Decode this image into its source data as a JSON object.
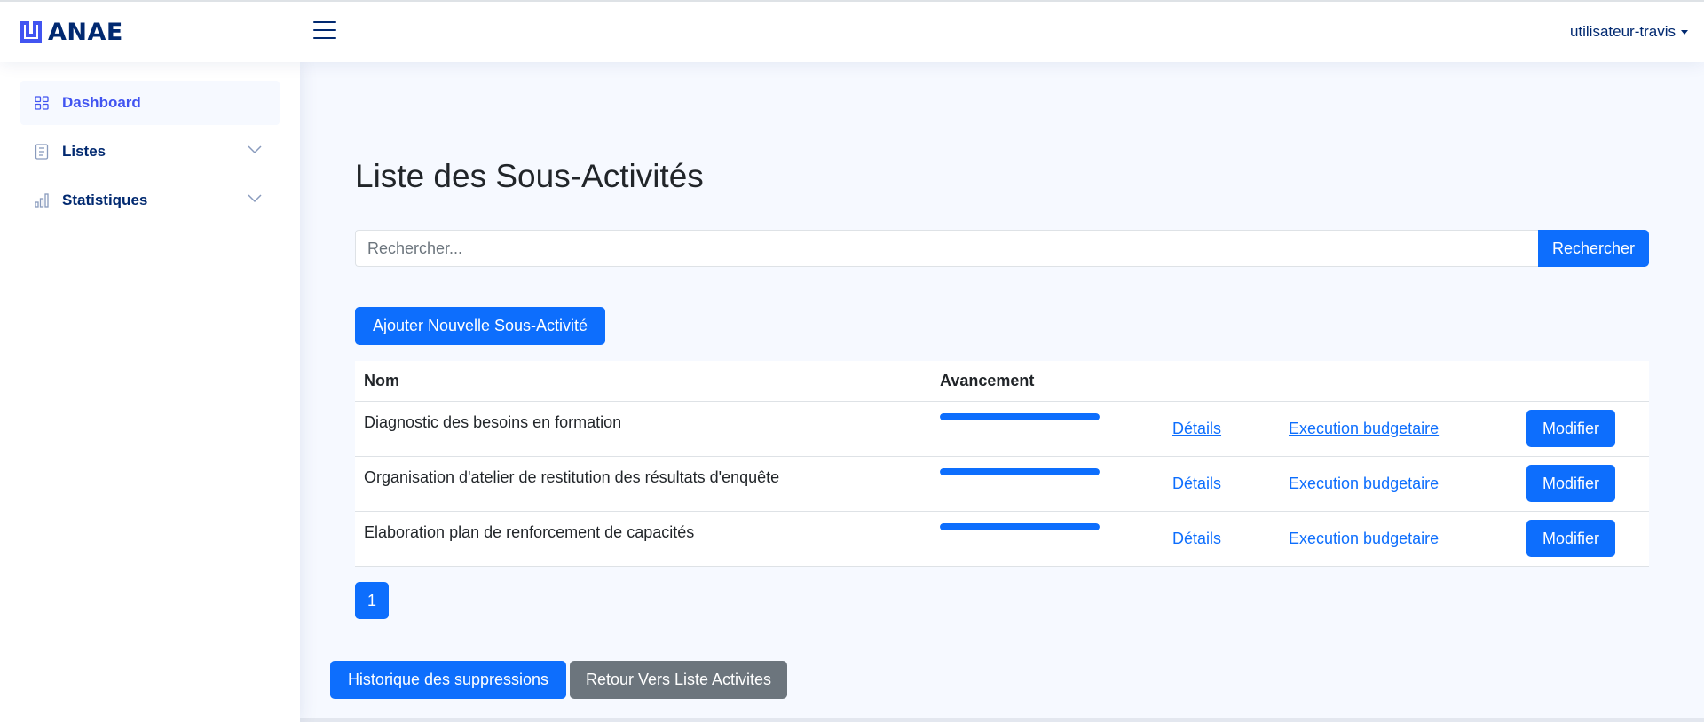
{
  "brand": {
    "name": "ANAE",
    "accent": "#4154f1",
    "primary": "#0d6efd"
  },
  "header": {
    "menu_icon": "hamburger-icon",
    "user": "utilisateur-travis"
  },
  "sidebar": {
    "items": [
      {
        "label": "Dashboard",
        "icon": "grid-icon"
      },
      {
        "label": "Listes",
        "icon": "list-icon"
      },
      {
        "label": "Statistiques",
        "icon": "bar-chart-icon"
      }
    ]
  },
  "main": {
    "title": "Liste des Sous-Activités",
    "search": {
      "placeholder": "Rechercher...",
      "button": "Rechercher"
    },
    "add_button": "Ajouter Nouvelle Sous-Activité",
    "table": {
      "headers": [
        "Nom",
        "Avancement"
      ],
      "rows": [
        {
          "name": "Diagnostic des besoins en formation",
          "progress": 1.0,
          "details": "Détails",
          "budget": "Execution budgetaire",
          "modify": "Modifier"
        },
        {
          "name": "Organisation d'atelier de restitution des résultats d'enquête",
          "progress": 1.0,
          "details": "Détails",
          "budget": "Execution budgetaire",
          "modify": "Modifier"
        },
        {
          "name": "Elaboration plan de renforcement de capacités",
          "progress": 1.0,
          "details": "Détails",
          "budget": "Execution budgetaire",
          "modify": "Modifier"
        }
      ]
    },
    "pagination": {
      "current": "1"
    },
    "history_button": "Historique des suppressions",
    "back_button": "Retour Vers Liste Activites"
  }
}
